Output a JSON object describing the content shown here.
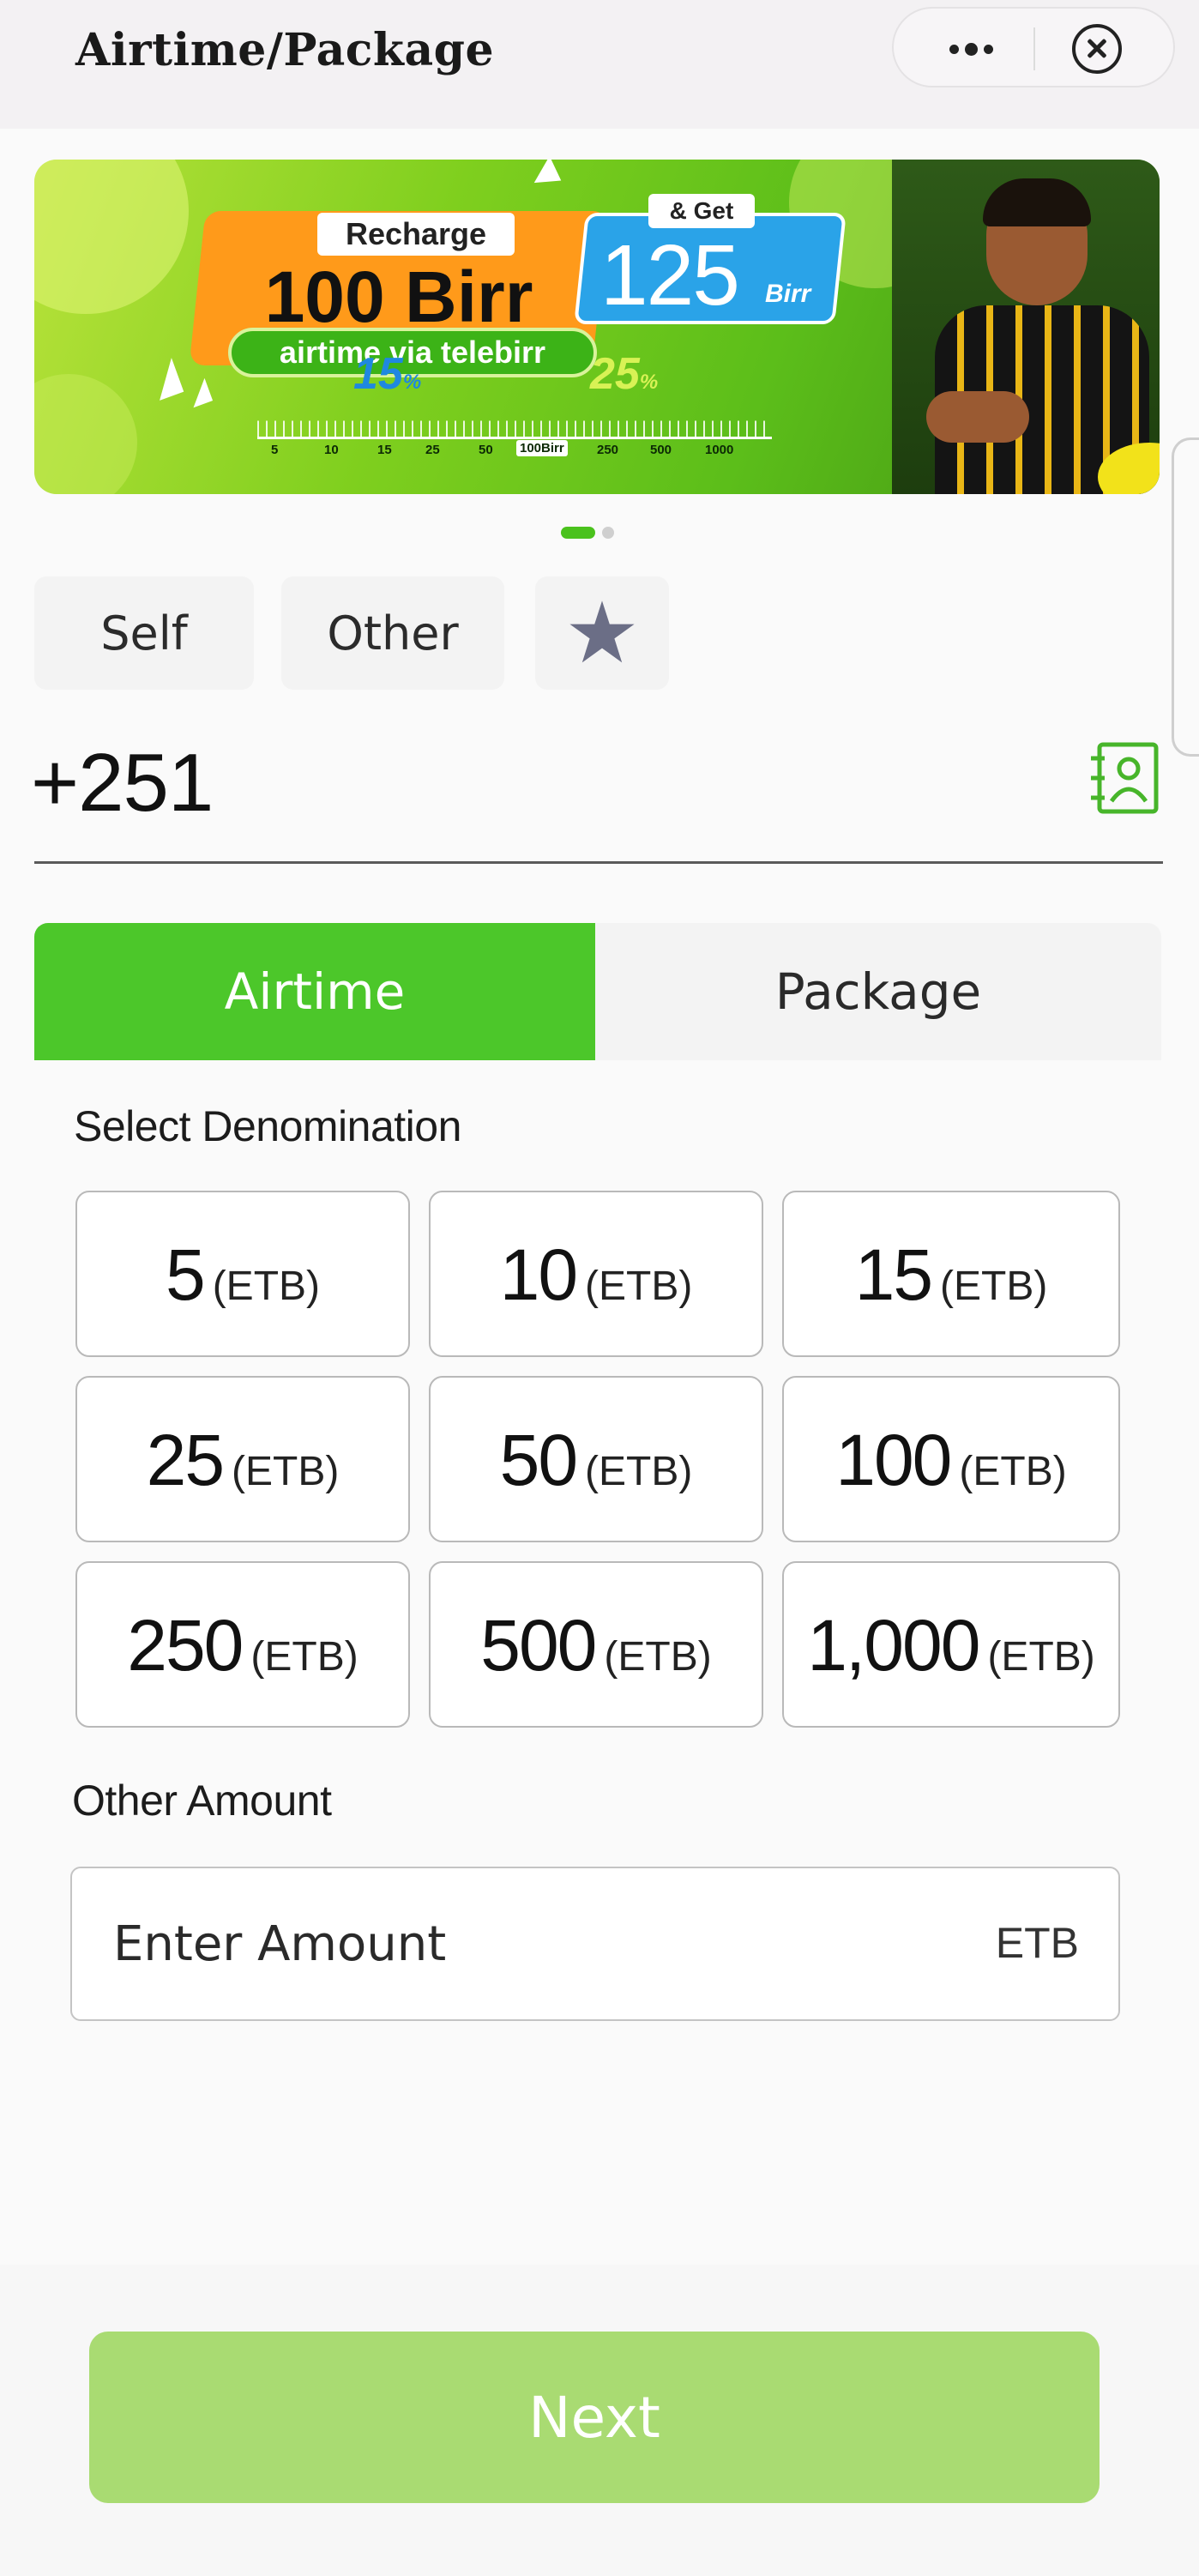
{
  "header": {
    "title": "Airtime/Package",
    "more_icon": "more-dots-icon",
    "close_icon": "close-circle-icon"
  },
  "banner": {
    "recharge_label": "Recharge",
    "recharge_amount": "100 Birr",
    "subtitle": "airtime via telebirr",
    "get_label": "& Get",
    "bonus_amount": "125",
    "bonus_currency": "Birr",
    "percent_a": "15",
    "percent_b": "25",
    "percent_sign": "%",
    "scale_labels": [
      "5",
      "10",
      "15",
      "25",
      "50",
      "100Birr",
      "250",
      "500",
      "1000"
    ],
    "active_slide": 1,
    "total_slides": 2
  },
  "recipient_tabs": {
    "self_label": "Self",
    "other_label": "Other",
    "favorite_icon": "star-icon"
  },
  "phone": {
    "prefix": "+251",
    "value": "",
    "contact_icon": "contact-book-icon"
  },
  "type_tabs": {
    "airtime_label": "Airtime",
    "package_label": "Package",
    "active": "Airtime"
  },
  "denomination": {
    "label": "Select Denomination",
    "currency": "(ETB)",
    "options": [
      "5",
      "10",
      "15",
      "25",
      "50",
      "100",
      "250",
      "500",
      "1,000"
    ]
  },
  "other_amount": {
    "label": "Other Amount",
    "placeholder": "Enter Amount",
    "suffix": "ETB"
  },
  "footer": {
    "next_label": "Next"
  },
  "colors": {
    "brand_green": "#4cc72a",
    "next_disabled": "#a9db72",
    "star_gray": "#6b6e86"
  }
}
